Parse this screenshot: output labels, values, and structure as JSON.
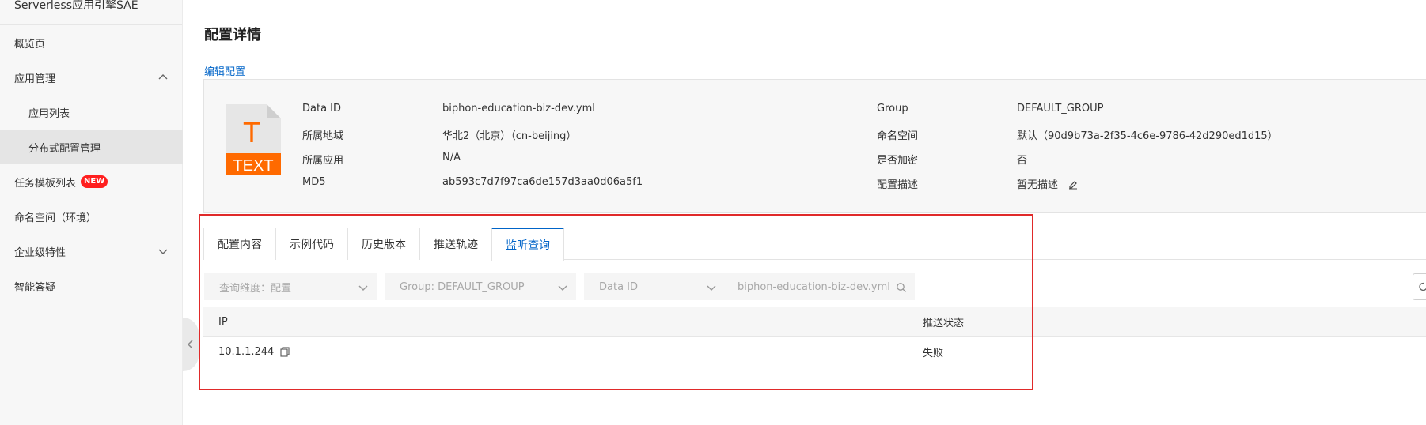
{
  "sidebar": {
    "title": "Serverless应用引擎SAE",
    "items": [
      {
        "label": "概览页"
      },
      {
        "label": "应用管理"
      },
      {
        "label": "应用列表"
      },
      {
        "label": "分布式配置管理"
      },
      {
        "label": "任务模板列表",
        "badge": "NEW"
      },
      {
        "label": "命名空间（环境）"
      },
      {
        "label": "企业级特性"
      },
      {
        "label": "智能答疑"
      }
    ]
  },
  "page": {
    "title": "配置详情",
    "edit_link": "编辑配置"
  },
  "info": {
    "file_icon": {
      "letter": "T",
      "text": "TEXT",
      "icon": "text-file-icon"
    },
    "left": [
      {
        "label": "Data ID",
        "value": "biphon-education-biz-dev.yml"
      },
      {
        "label": "所属地域",
        "value": "华北2（北京）（cn-beijing）"
      },
      {
        "label": "所属应用",
        "value": "N/A"
      },
      {
        "label": "MD5",
        "value": "ab593c7d7f97ca6de157d3aa0d06a5f1"
      }
    ],
    "right": [
      {
        "label": "Group",
        "value": "DEFAULT_GROUP"
      },
      {
        "label": "命名空间",
        "value": "默认（90d9b73a-2f35-4c6e-9786-42d290ed1d15）"
      },
      {
        "label": "是否加密",
        "value": "否"
      },
      {
        "label": "配置描述",
        "value": "暂无描述"
      }
    ]
  },
  "tabs": [
    {
      "label": "配置内容"
    },
    {
      "label": "示例代码"
    },
    {
      "label": "历史版本"
    },
    {
      "label": "推送轨迹"
    },
    {
      "label": "监听查询"
    }
  ],
  "active_tab_index": 4,
  "filters": {
    "dimension": "查询维度：配置",
    "group": "Group: DEFAULT_GROUP",
    "data_id_type": "Data ID",
    "data_id_value": "biphon-education-biz-dev.yml"
  },
  "table": {
    "columns": [
      "IP",
      "推送状态"
    ],
    "rows": [
      {
        "ip": "10.1.1.244",
        "status": "失败"
      }
    ]
  },
  "colors": {
    "accent": "#0064c8",
    "highlight": "#e02a2a",
    "file_icon": "#ff6a00"
  }
}
